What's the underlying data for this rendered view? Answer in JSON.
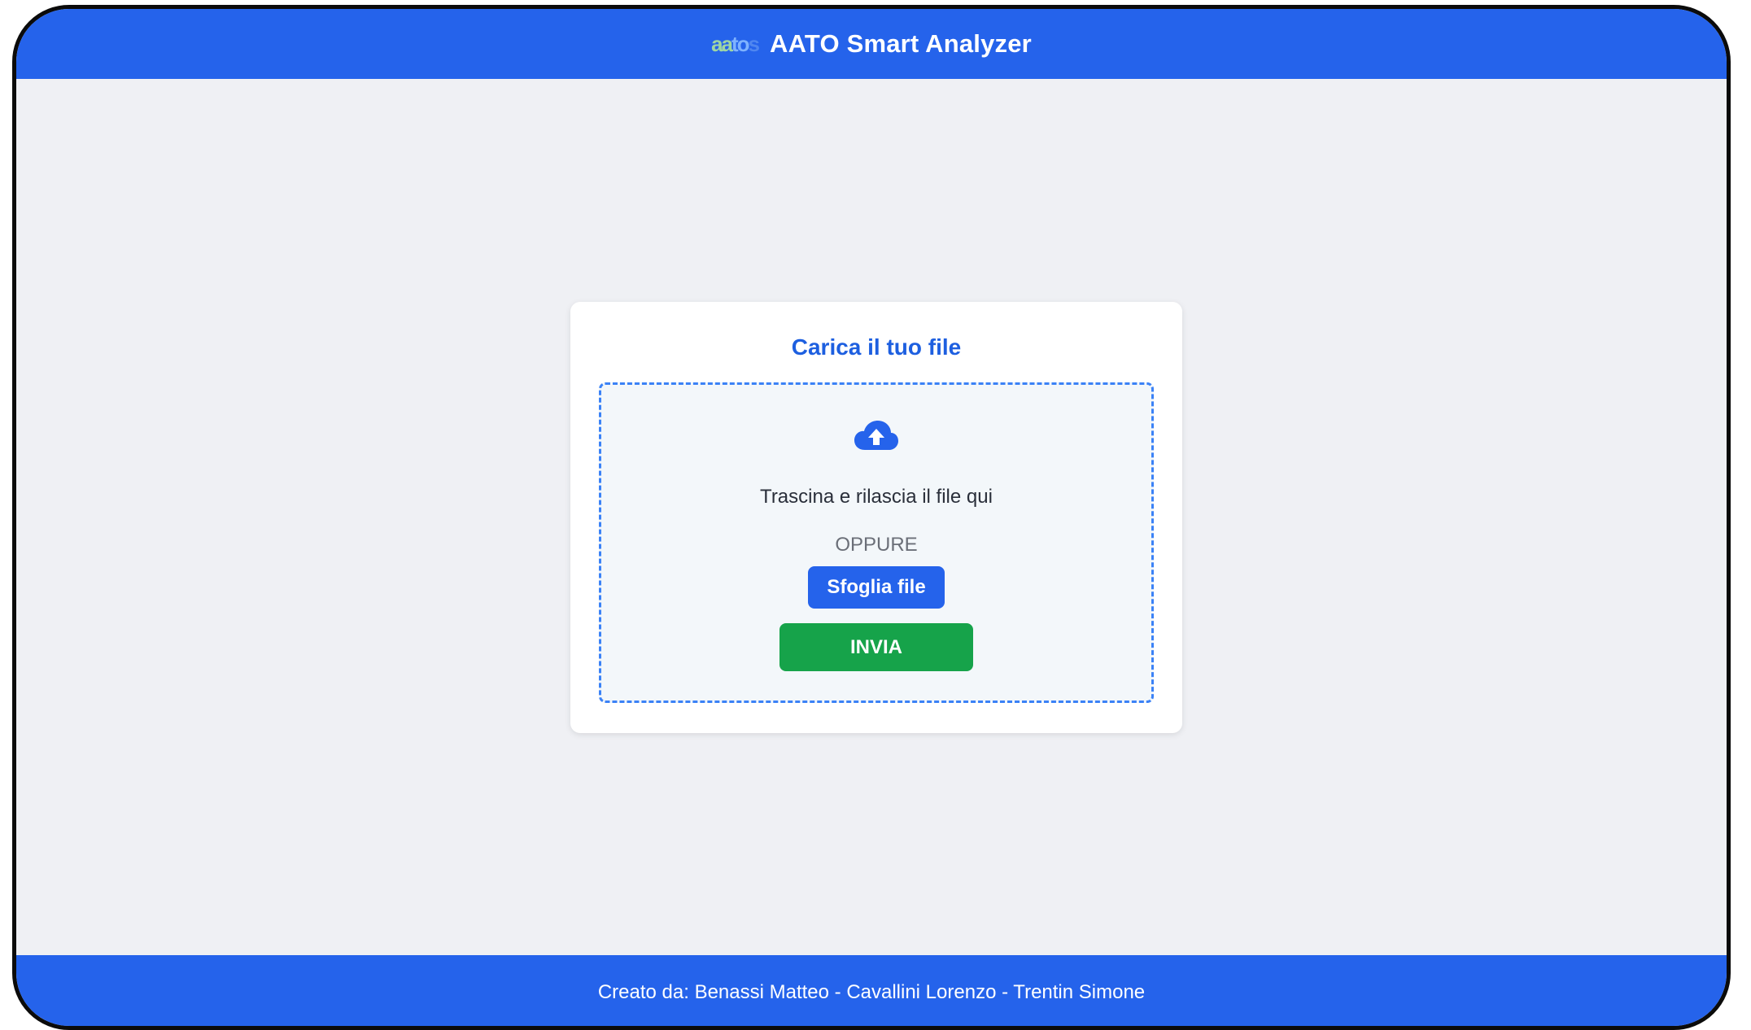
{
  "header": {
    "logo_text": [
      "aa",
      "to",
      "s"
    ],
    "title": "AATO Smart Analyzer",
    "background": "#2563eb"
  },
  "upload": {
    "title": "Carica il tuo file",
    "icon": "cloud-upload-icon",
    "drop_text": "Trascina e rilascia il file qui",
    "or_text": "OPPURE",
    "browse_label": "Sfoglia file",
    "submit_label": "INVIA",
    "accent": "#2563eb",
    "submit_color": "#16a34a"
  },
  "footer": {
    "text": "Creato da: Benassi Matteo - Cavallini Lorenzo - Trentin Simone"
  }
}
